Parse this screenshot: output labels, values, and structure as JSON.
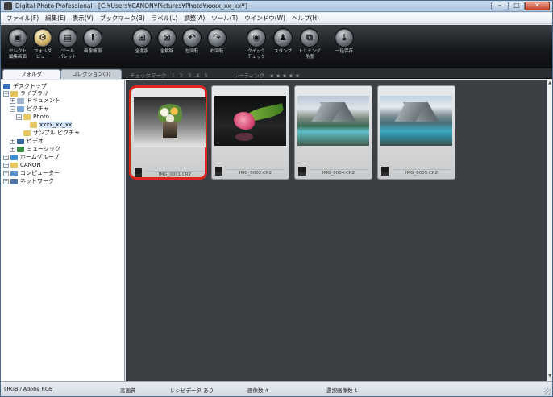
{
  "window": {
    "title": "Digital Photo Professional - [C:¥Users¥CANON¥Pictures¥Photo¥xxxx_xx_xx¥]"
  },
  "menu": [
    "ファイル(F)",
    "編集(E)",
    "表示(V)",
    "ブックマーク(B)",
    "ラベル(L)",
    "調整(A)",
    "ツール(T)",
    "ウインドウ(W)",
    "ヘルプ(H)"
  ],
  "toolbar": [
    {
      "icon": "select-edit-icon",
      "label": "セレクト\n編集画面"
    },
    {
      "icon": "folder-view-icon",
      "label": "フォルダ\nビュー"
    },
    {
      "icon": "tool-palette-icon",
      "label": "ツール\nパレット"
    },
    {
      "icon": "info-icon",
      "label": "画像情報"
    },
    {
      "icon": "select-all-icon",
      "label": "全選択"
    },
    {
      "icon": "deselect-all-icon",
      "label": "全解除"
    },
    {
      "icon": "rotate-left-icon",
      "label": "左回転"
    },
    {
      "icon": "rotate-right-icon",
      "label": "右回転"
    },
    {
      "icon": "quick-check-icon",
      "label": "クイック\nチェック"
    },
    {
      "icon": "stamp-icon",
      "label": "スタンプ"
    },
    {
      "icon": "trim-icon",
      "label": "トリミング\n角度"
    },
    {
      "icon": "batch-save-icon",
      "label": "一括保存"
    }
  ],
  "tabs": {
    "folder": "フォルダ",
    "collection": "コレクション(0)"
  },
  "filter": {
    "check_label": "チェックマーク",
    "checks": [
      "1",
      "2",
      "3",
      "4",
      "5"
    ],
    "rating_label": "レーティング",
    "stars": "★ ★ ★ ★ ★"
  },
  "tree": [
    {
      "label": "デスクトップ",
      "icon": "desktop",
      "exp": ""
    },
    {
      "label": "ライブラリ",
      "icon": "library",
      "exp": "−"
    },
    {
      "label": "ドキュメント",
      "icon": "doc",
      "exp": "+"
    },
    {
      "label": "ピクチャ",
      "icon": "pic",
      "exp": "−"
    },
    {
      "label": "Photo",
      "icon": "folder",
      "exp": "−"
    },
    {
      "label": "xxxx_xx_xx",
      "icon": "folder",
      "exp": ""
    },
    {
      "label": "サンプル ピクチャ",
      "icon": "folder",
      "exp": ""
    },
    {
      "label": "ビデオ",
      "icon": "video",
      "exp": "+"
    },
    {
      "label": "ミュージック",
      "icon": "music",
      "exp": "+"
    },
    {
      "label": "ホームグループ",
      "icon": "home",
      "exp": "+"
    },
    {
      "label": "CANON",
      "icon": "canon",
      "exp": "+"
    },
    {
      "label": "コンピューター",
      "icon": "pc",
      "exp": "+"
    },
    {
      "label": "ネットワーク",
      "icon": "net",
      "exp": "+"
    }
  ],
  "thumbnails": [
    {
      "filename": "IMG_0001.CR2",
      "selected": true
    },
    {
      "filename": "IMG_0002.CR2",
      "selected": false
    },
    {
      "filename": "IMG_0004.CR2",
      "selected": false
    },
    {
      "filename": "IMG_0005.CR2",
      "selected": false
    }
  ],
  "status": {
    "color_space": "sRGB / Adobe RGB",
    "quality": "高画質",
    "recipe": "レシピデータ あり",
    "image_count": "画像数 4",
    "selected_count": "選択画像数 1"
  }
}
